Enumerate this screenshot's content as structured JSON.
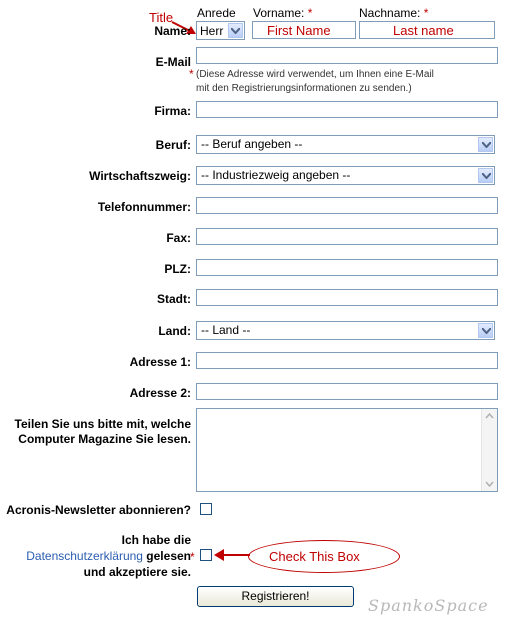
{
  "annotations": {
    "title": "Title",
    "first_name": "First Name",
    "last_name": "Last name",
    "check_box": "Check This Box",
    "watermark": "SpankoSpace"
  },
  "name_row": {
    "label": "Name:",
    "salutation_header": "Anrede",
    "salutation_value": "Herr",
    "firstname_header": "Vorname:",
    "lastname_header": "Nachname:",
    "required_mark": "*"
  },
  "email": {
    "label": "E-Mail",
    "required_mark": "*",
    "hint_line1": "(Diese Adresse wird verwendet, um Ihnen eine E-Mail",
    "hint_line2": "mit den Registrierungsinformationen zu senden.)"
  },
  "fields": {
    "firma": "Firma:",
    "beruf": "Beruf:",
    "beruf_value": "-- Beruf angeben --",
    "branche": "Wirtschaftszweig:",
    "branche_value": "-- Industriezweig angeben --",
    "telefon": "Telefonnummer:",
    "fax": "Fax:",
    "plz": "PLZ:",
    "stadt": "Stadt:",
    "land": "Land:",
    "land_value": "-- Land --",
    "adresse1": "Adresse 1:",
    "adresse2": "Adresse 2:",
    "magazine_line1": "Teilen Sie uns bitte mit, welche",
    "magazine_line2": "Computer Magazine Sie lesen."
  },
  "newsletter": {
    "label": "Acronis-Newsletter abonnieren?"
  },
  "privacy": {
    "line1": "Ich habe die",
    "link": "Datenschutzerklärung",
    "line2_rest": " gelesen",
    "line3": "und akzeptiere sie.",
    "required_mark": "*"
  },
  "submit": {
    "label": "Registrieren!"
  }
}
